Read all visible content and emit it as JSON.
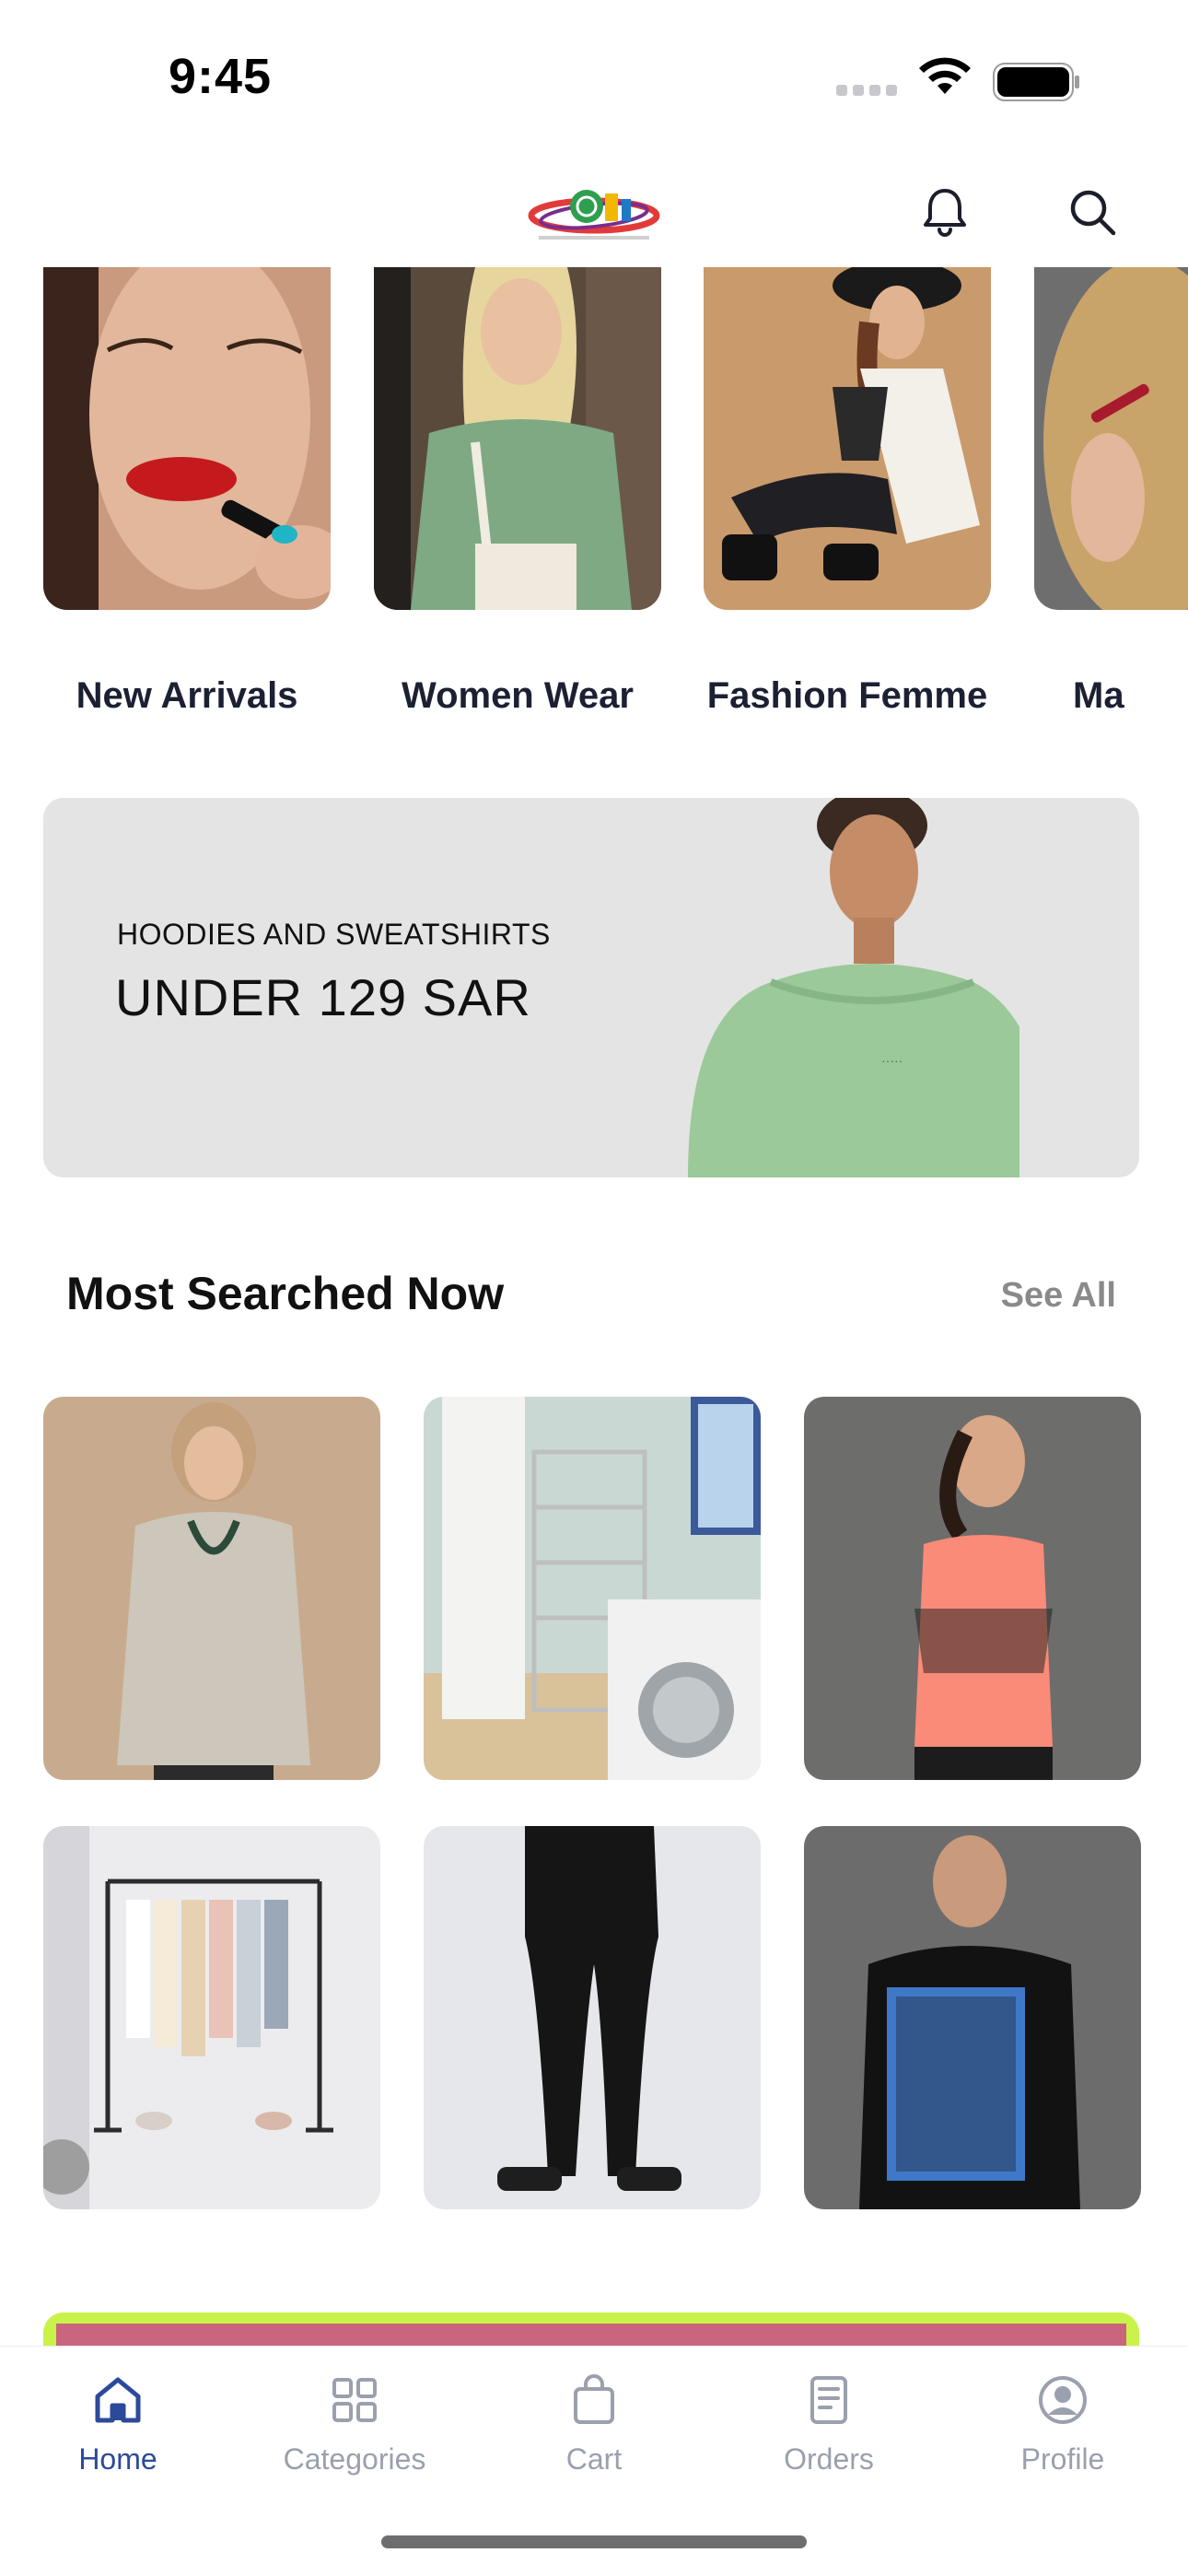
{
  "status_bar": {
    "time": "9:45"
  },
  "header": {
    "logo_name": "brand-logo",
    "icons": [
      "bell-icon",
      "search-icon"
    ]
  },
  "categories": [
    {
      "label": "New Arrivals"
    },
    {
      "label": "Women Wear"
    },
    {
      "label": "Fashion Femme"
    },
    {
      "label": "Ma"
    }
  ],
  "banner": {
    "subtitle": "HOODIES AND SWEATSHIRTS",
    "title": "UNDER 129 SAR"
  },
  "most_searched": {
    "title": "Most Searched Now",
    "see_all": "See All"
  },
  "tabbar": {
    "items": [
      {
        "label": "Home",
        "icon": "home-icon",
        "active": true
      },
      {
        "label": "Categories",
        "icon": "grid-icon",
        "active": false
      },
      {
        "label": "Cart",
        "icon": "bag-icon",
        "active": false
      },
      {
        "label": "Orders",
        "icon": "receipt-icon",
        "active": false
      },
      {
        "label": "Profile",
        "icon": "user-circle-icon",
        "active": false
      }
    ]
  },
  "colors": {
    "accent": "#2c4a9a",
    "inactive": "#9aa0ad",
    "banner_bg": "#e4e4e4",
    "promo_border": "#c9f24a"
  }
}
